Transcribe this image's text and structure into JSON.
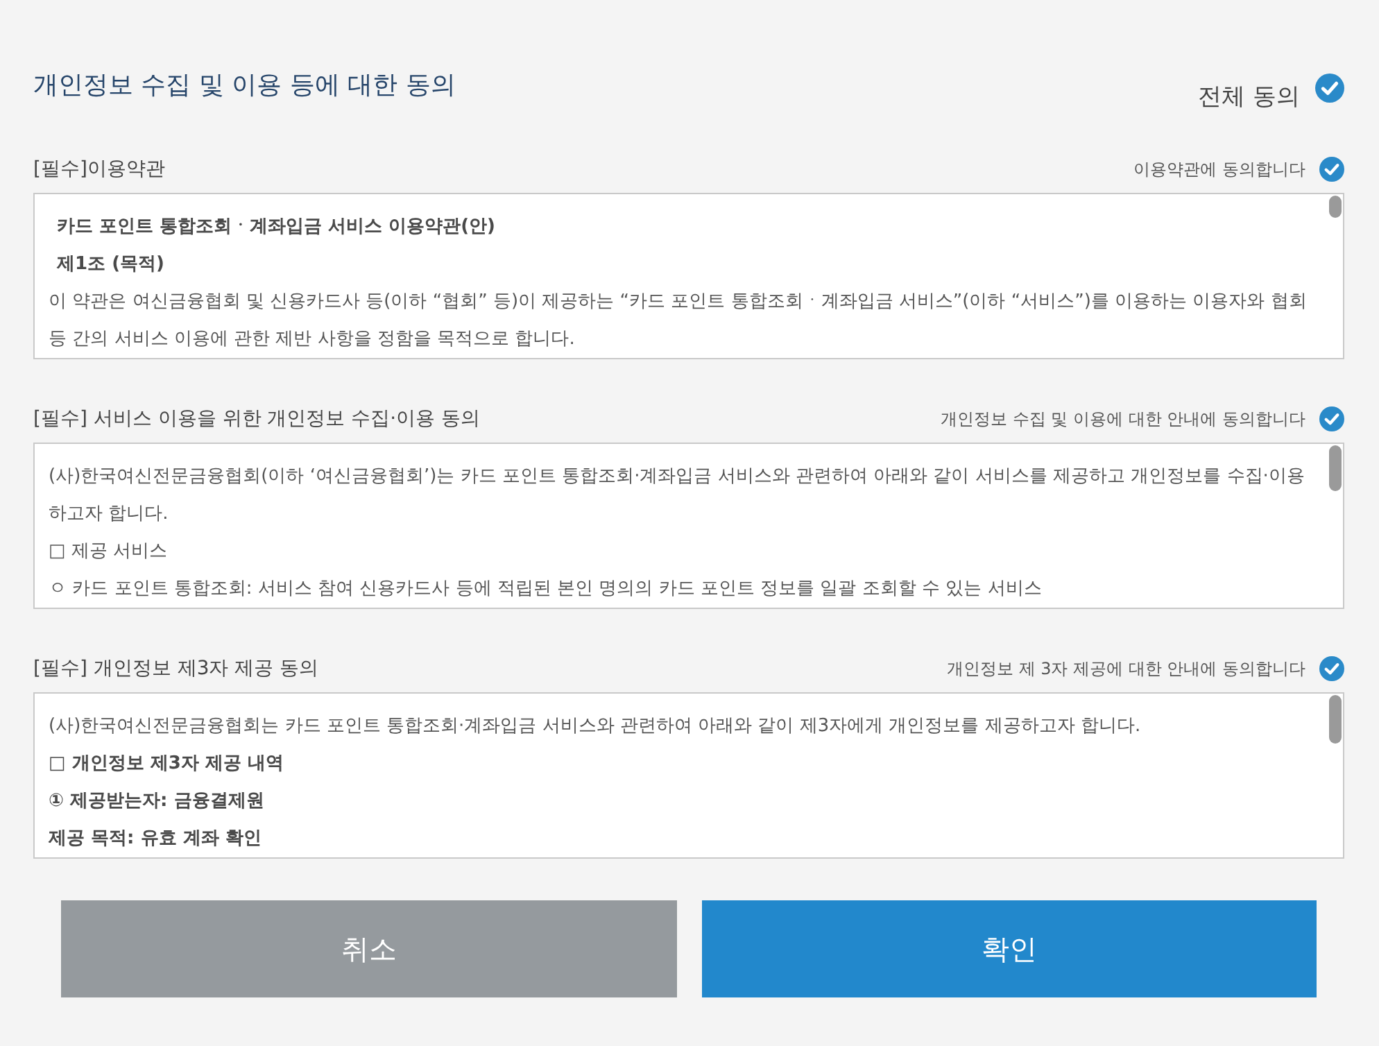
{
  "title": "개인정보 수집 및 이용 등에 대한 동의",
  "agree_all": {
    "label": "전체 동의",
    "checked": true
  },
  "sections": [
    {
      "label": "[필수]이용약관",
      "agree_label": "이용약관에 동의합니다",
      "checked": true,
      "content": [
        {
          "kind": "heading",
          "text": "카드 포인트 통합조회ㆍ계좌입금 서비스 이용약관(안)"
        },
        {
          "kind": "heading",
          "text": "제1조 (목적)"
        },
        {
          "kind": "body",
          "text": "이 약관은 여신금융협회 및 신용카드사 등(이하 “협회” 등)이 제공하는 “카드 포인트 통합조회ㆍ계좌입금 서비스”(이하 “서비스”)를 이용하는 이용자와 협회 등 간의 서비스 이용에 관한 제반 사항을 정함을 목적으로 합니다."
        }
      ]
    },
    {
      "label": "[필수] 서비스 이용을 위한 개인정보 수집·이용 동의",
      "agree_label": "개인정보 수집 및 이용에 대한 안내에 동의합니다",
      "checked": true,
      "content": [
        {
          "kind": "body",
          "text": "(사)한국여신전문금융협회(이하 ‘여신금융협회’)는 카드 포인트 통합조회·계좌입금 서비스와 관련하여 아래와 같이 서비스를 제공하고 개인정보를 수집·이용하고자 합니다."
        },
        {
          "kind": "body",
          "text": "□ 제공 서비스"
        },
        {
          "kind": "body",
          "text": "ㅇ 카드 포인트 통합조회: 서비스 참여 신용카드사 등에 적립된 본인 명의의 카드 포인트 정보를 일괄 조회할 수 있는 서비스"
        }
      ]
    },
    {
      "label": "[필수] 개인정보 제3자 제공 동의",
      "agree_label": "개인정보 제 3자 제공에 대한 안내에 동의합니다",
      "checked": true,
      "content": [
        {
          "kind": "body",
          "text": "(사)한국여신전문금융협회는 카드 포인트 통합조회·계좌입금 서비스와 관련하여 아래와 같이 제3자에게 개인정보를 제공하고자 합니다."
        },
        {
          "kind": "strong",
          "text": "□ 개인정보 제3자 제공 내역"
        },
        {
          "kind": "strong",
          "text": "① 제공받는자: 금융결제원"
        },
        {
          "kind": "strong",
          "text": "제공 목적: 유효 계좌 확인"
        }
      ]
    }
  ],
  "buttons": [
    {
      "label": "취소",
      "kind": "cancel"
    },
    {
      "label": "확인",
      "kind": "confirm"
    }
  ]
}
